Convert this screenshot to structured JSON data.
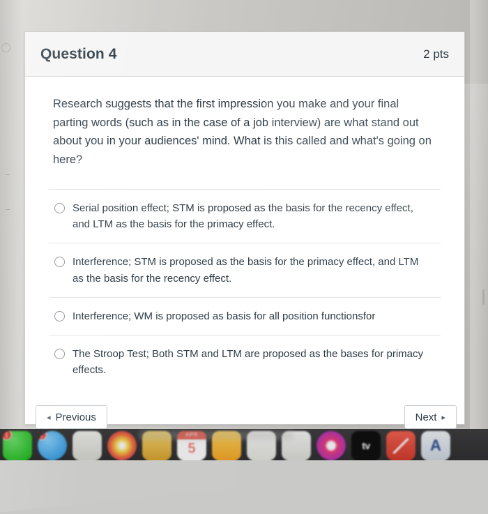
{
  "question": {
    "title": "Question 4",
    "points": "2 pts",
    "prompt": "Research suggests that the first impression you make and your final parting words (such as in the case of a job interview) are what stand out about you in your audiences' mind. What is this called and what's going on here?",
    "answers": [
      "Serial position effect; STM is proposed as the basis for the recency effect, and LTM as the basis for the primacy effect.",
      "Interference; STM is proposed as the basis for the primacy effect, and LTM as the basis for the recency effect.",
      "Interference; WM is proposed as basis for all position functionsfor",
      "The Stroop Test; Both STM and LTM are proposed as the bases for primacy effects."
    ]
  },
  "nav": {
    "previous_label": "Previous",
    "previous_arrow": "◂",
    "next_label": "Next",
    "next_arrow": "▸"
  },
  "dock": {
    "apps": [
      {
        "name": "messages",
        "badge": "1"
      },
      {
        "name": "facetime",
        "badge": "1"
      },
      {
        "name": "books",
        "badge": ""
      },
      {
        "name": "photos",
        "badge": ""
      },
      {
        "name": "notes",
        "badge": ""
      },
      {
        "name": "calendar",
        "month": "APR",
        "day": "5"
      },
      {
        "name": "pages",
        "badge": ""
      },
      {
        "name": "numbers",
        "badge": ""
      },
      {
        "name": "mail",
        "badge": ""
      },
      {
        "name": "music",
        "badge": ""
      },
      {
        "name": "apple-tv",
        "label": "tv"
      },
      {
        "name": "no-entry",
        "badge": ""
      },
      {
        "name": "app-store",
        "label": "A"
      }
    ]
  }
}
